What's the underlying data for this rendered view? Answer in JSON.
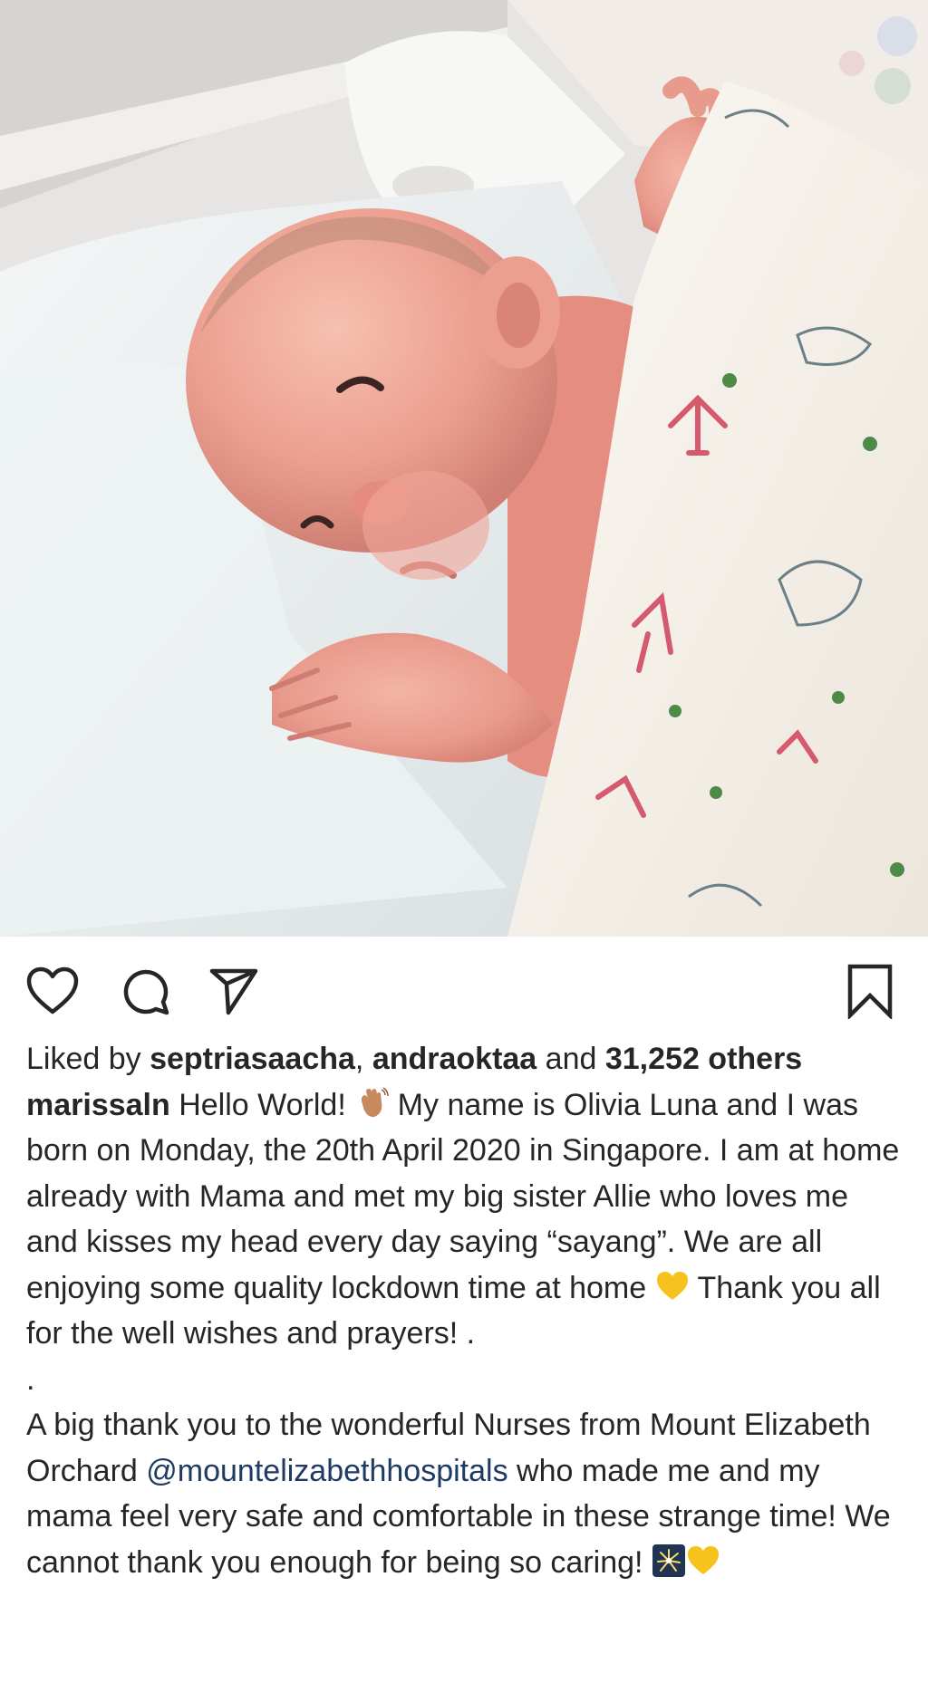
{
  "post": {
    "image_alt": "newborn baby lying on white towel under animal-print blanket",
    "colors": {
      "text": "#262626",
      "mention": "#1f3a63",
      "heart_emoji": "#f7c21d",
      "wave_emoji": "#c68a5c"
    },
    "actions": {
      "like": "heart-outline-icon",
      "comment": "speech-bubble-icon",
      "share": "paper-plane-icon",
      "save": "bookmark-icon"
    },
    "likes": {
      "prefix": "Liked by",
      "user1": "septriasaacha",
      "sep": ",",
      "user2": "andraoktaa",
      "and": "and",
      "count": "31,252 others"
    },
    "caption": {
      "username": "marissaln",
      "part1": "Hello World!",
      "part2": "My name is Olivia Luna and I was born on Monday, the 20th April 2020 in Singapore. I am at home already with Mama and met my big sister Allie who loves me and kisses my head every day saying “sayang”. We are all enjoying some quality lockdown time at home",
      "part3": "Thank you all for the well wishes and prayers! .",
      "dot": ".",
      "part4": "A big thank you to the wonderful Nurses from Mount Elizabeth Orchard",
      "mention": "@mountelizabethhospitals",
      "part5": "who made me and my mama feel very safe and comfortable in these strange time! We cannot thank you enough for being so caring!"
    }
  }
}
